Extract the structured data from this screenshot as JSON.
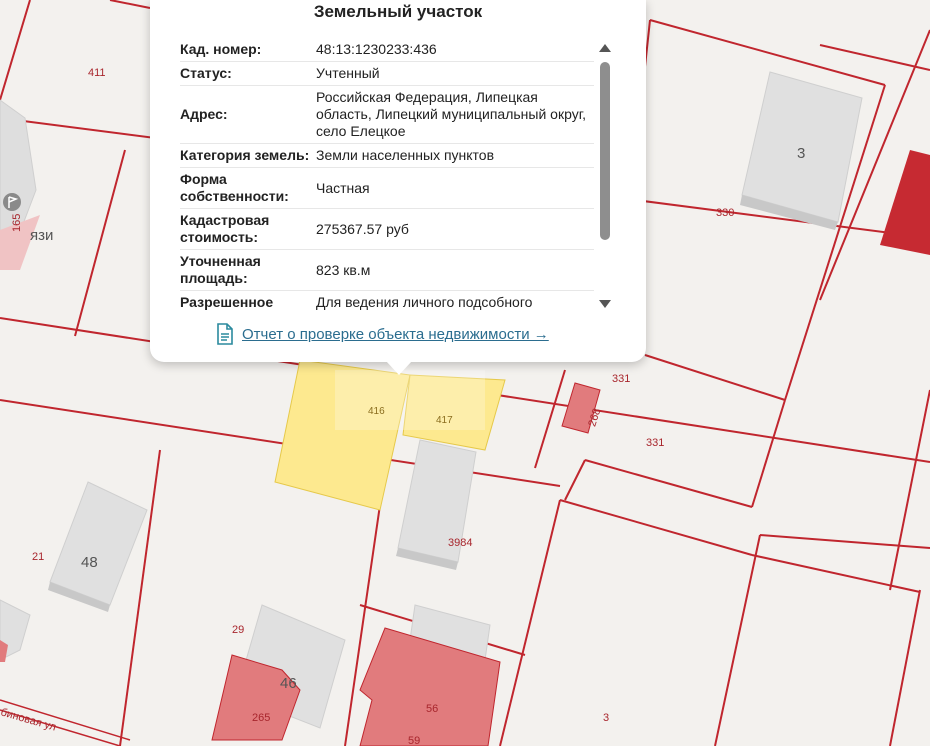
{
  "popup": {
    "title": "Земельный участок",
    "rows": [
      {
        "key": "Кад. номер:",
        "value": "48:13:1230233:436"
      },
      {
        "key": "Статус:",
        "value": "Учтенный"
      },
      {
        "key": "Адрес:",
        "value": "Российская Федерация, Липецкая область, Липецкий муниципальный округ, село Елецкое"
      },
      {
        "key": "Категория земель:",
        "value": "Земли населенных пунктов"
      },
      {
        "key": "Форма собственности:",
        "value": "Частная"
      },
      {
        "key": "Кадастровая стоимость:",
        "value": "275367.57 руб"
      },
      {
        "key": "Уточненная площадь:",
        "value": "823 кв.м"
      },
      {
        "key": "Разрешенное",
        "value": "Для ведения личного подсобного"
      }
    ],
    "report_link": "Отчет о проверке объекта недвижимости →",
    "icons": {
      "report": "document-icon",
      "scroll_up": "arrow-up-icon",
      "scroll_down": "arrow-down-icon"
    }
  },
  "map": {
    "parcel_labels": [
      "411",
      "330",
      "331",
      "331",
      "268",
      "21",
      "29",
      "3984",
      "3",
      "165"
    ],
    "building_labels": [
      "3",
      "48",
      "46",
      "265",
      "56",
      "59"
    ],
    "highlighted_parcels": [
      "416",
      "417"
    ],
    "street_label": "бинoвая ул",
    "fragment_label": "язи",
    "colors": {
      "parcel_border": "#c0262e",
      "highlight": "#fde98f",
      "building_gray": "#e0e0e0",
      "building_red": "#e17b7d",
      "building_dark_red": "#c62a32"
    }
  }
}
